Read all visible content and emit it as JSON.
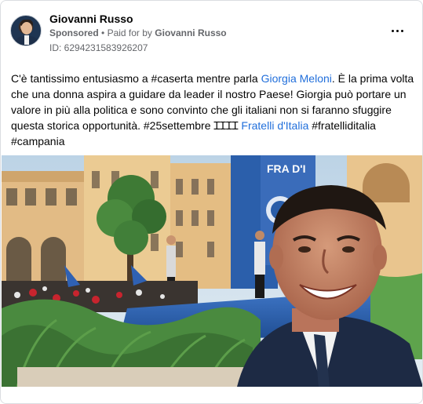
{
  "post": {
    "author_name": "Giovanni Russo",
    "sponsored_label": "Sponsored",
    "separator": "•",
    "paid_for_prefix": "Paid for by",
    "paid_for_name": "Giovanni Russo",
    "ad_id": "ID: 6294231583926207",
    "more_icon": "more-horizontal-icon",
    "text_segments": [
      {
        "text": "C'è tantissimo entusiasmo a #caserta mentre parla ",
        "link": false
      },
      {
        "text": "Giorgia Meloni",
        "link": true
      },
      {
        "text": ". È la prima volta che una donna aspira a guidare da leader il nostro Paese! Giorgia può portare un valore in più alla politica e sono convinto che gli italiani non si faranno sfuggire questa storica opportunità. #25settembre ",
        "link": false
      },
      {
        "text": "ꞮꞮꞮꞮ",
        "link": false
      },
      {
        "text": " ",
        "link": false
      },
      {
        "text": "Fratelli d'Italia",
        "link": true
      },
      {
        "text": " #fratelliditalia #campania",
        "link": false
      }
    ]
  },
  "photo": {
    "sign_text": "FRA D'I",
    "colors": {
      "sky": "#c9dcea",
      "building": "#e9c58e",
      "stage_blue": "#2a5da8",
      "plants": "#3f7a3a",
      "suit": "#1d2a44",
      "link": "#216fdb",
      "meta": "#65676b"
    }
  }
}
